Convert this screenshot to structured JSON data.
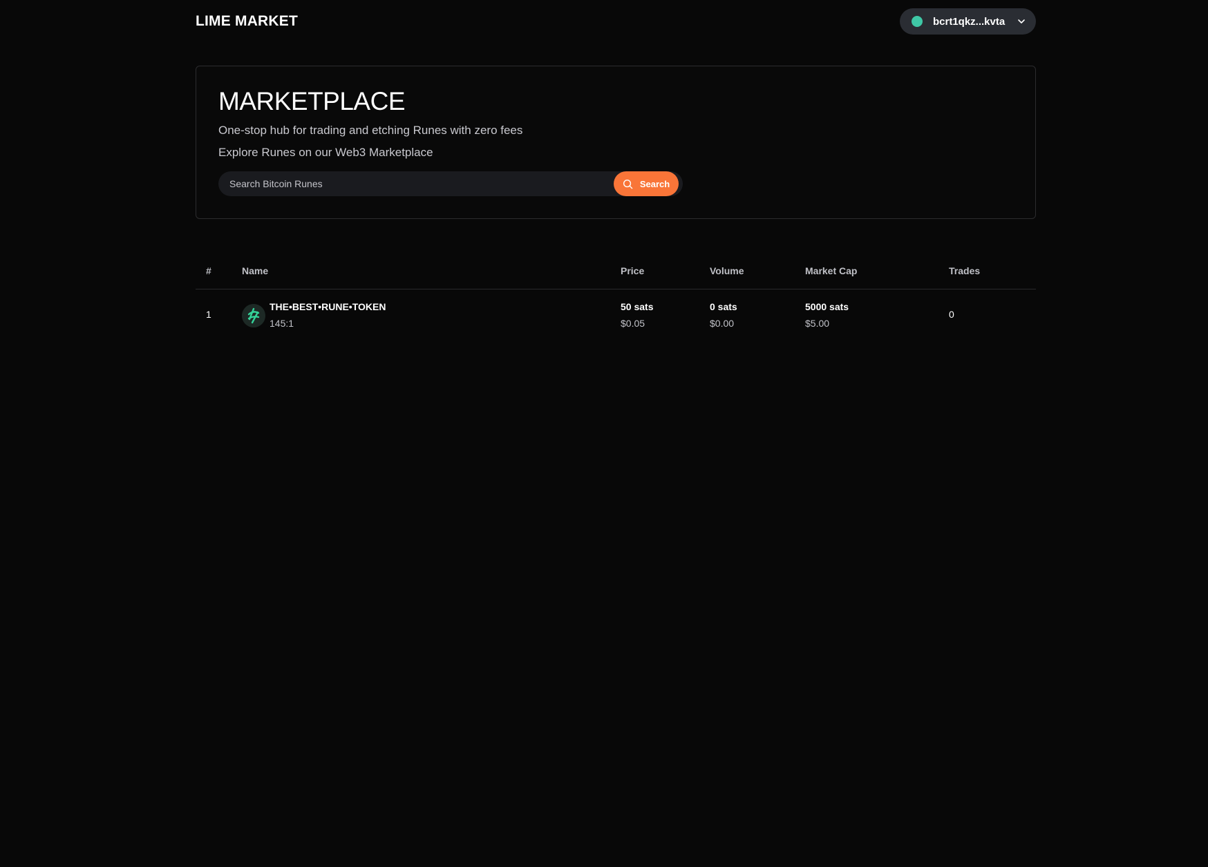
{
  "header": {
    "brand": "LIME MARKET",
    "wallet": {
      "address": "bcrt1qkz...kvta",
      "status_color": "#3fc8a6"
    }
  },
  "hero": {
    "title": "MARKETPLACE",
    "subtitle_1": "One-stop hub for trading and etching Runes with zero fees",
    "subtitle_2": "Explore Runes on our Web3 Marketplace",
    "search": {
      "placeholder": "Search Bitcoin Runes",
      "value": "",
      "button_label": "Search",
      "button_color": "#f97538"
    }
  },
  "table": {
    "columns": {
      "rank": "#",
      "name": "Name",
      "price": "Price",
      "volume": "Volume",
      "market_cap": "Market Cap",
      "trades": "Trades"
    },
    "rows": [
      {
        "rank": "1",
        "icon": "rune-token-logo",
        "name": "THE•BEST•RUNE•TOKEN",
        "id": "145:1",
        "price_sats": "50 sats",
        "price_usd": "$0.05",
        "volume_sats": "0 sats",
        "volume_usd": "$0.00",
        "market_cap_sats": "5000 sats",
        "market_cap_usd": "$5.00",
        "trades": "0"
      }
    ]
  }
}
